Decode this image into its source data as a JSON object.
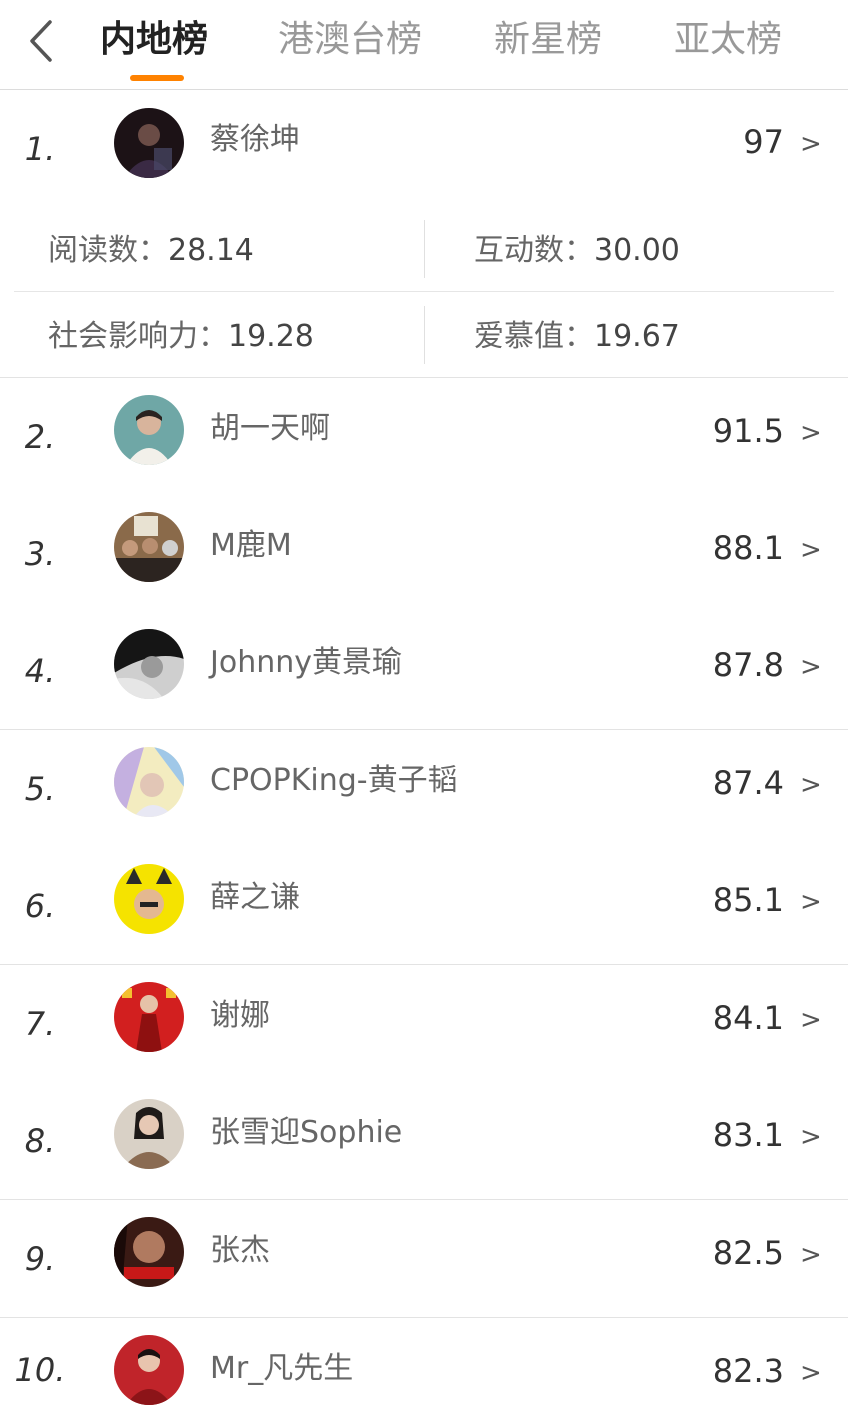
{
  "header": {
    "tabs": [
      {
        "label": "内地榜",
        "active": true
      },
      {
        "label": "港澳台榜",
        "active": false
      },
      {
        "label": "新星榜",
        "active": false
      },
      {
        "label": "亚太榜",
        "active": false
      }
    ],
    "accent_color": "#ff8200"
  },
  "top_entry": {
    "rank": "1.",
    "name": "蔡徐坤",
    "score": "97",
    "chevron": ">",
    "stats": {
      "reads_label": "阅读数：",
      "reads_value": "28.14",
      "interactions_label": "互动数：",
      "interactions_value": "30.00",
      "influence_label": "社会影响力：",
      "influence_value": "19.28",
      "love_label": "爱慕值：",
      "love_value": "19.67"
    }
  },
  "rankings": [
    {
      "rank": "2.",
      "name": "胡一天啊",
      "score": "91.5",
      "chevron": ">"
    },
    {
      "rank": "3.",
      "name": "M鹿M",
      "score": "88.1",
      "chevron": ">"
    },
    {
      "rank": "4.",
      "name": "Johnny黄景瑜",
      "score": "87.8",
      "chevron": ">"
    },
    {
      "rank": "5.",
      "name": "CPOPKing-黄子韬",
      "score": "87.4",
      "chevron": ">"
    },
    {
      "rank": "6.",
      "name": "薛之谦",
      "score": "85.1",
      "chevron": ">"
    },
    {
      "rank": "7.",
      "name": "谢娜",
      "score": "84.1",
      "chevron": ">"
    },
    {
      "rank": "8.",
      "name": "张雪迎Sophie",
      "score": "83.1",
      "chevron": ">"
    },
    {
      "rank": "9.",
      "name": "张杰",
      "score": "82.5",
      "chevron": ">"
    },
    {
      "rank": "10.",
      "name": "Mr_凡先生",
      "score": "82.3",
      "chevron": ">"
    }
  ]
}
